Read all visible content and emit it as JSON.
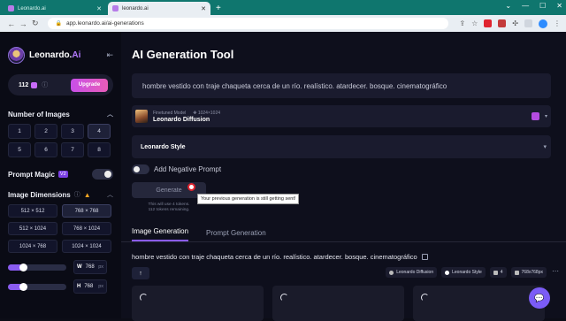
{
  "browser": {
    "tabs": [
      {
        "title": "Leonardo.ai",
        "active": false
      },
      {
        "title": "leonardo.ai",
        "active": true
      }
    ],
    "new_tab": "+",
    "url": "app.leonardo.ai/ai-generations",
    "icons": [
      "back-arrow",
      "forward-arrow",
      "reload",
      "lock",
      "share",
      "star",
      "extensions",
      "profile",
      "menu"
    ]
  },
  "sidebar": {
    "brand": "Leonardo.",
    "brand_suffix": "Ai",
    "collapse_icon": "collapse-arrow",
    "tokens": "112",
    "upgrade_label": "Upgrade",
    "number_of_images": {
      "title": "Number of Images",
      "options": [
        "1",
        "2",
        "3",
        "4",
        "5",
        "6",
        "7",
        "8"
      ],
      "selected": "4"
    },
    "prompt_magic": {
      "label": "Prompt Magic",
      "badge": "V2"
    },
    "image_dimensions": {
      "title": "Image Dimensions",
      "options": [
        "512 × 512",
        "768 × 768",
        "512 × 1024",
        "768 × 1024",
        "1024 × 768",
        "1024 × 1024"
      ],
      "selected": "768 × 768"
    },
    "width": {
      "label": "W",
      "value": "768",
      "unit": "px",
      "level": 0.25
    },
    "height": {
      "label": "H",
      "value": "768",
      "unit": "px",
      "level": 0.25
    }
  },
  "main": {
    "title": "AI Generation Tool",
    "prompt": "hombre vestido con traje chaqueta cerca de un río. realístico. atardecer. bosque. cinematográfico",
    "model": {
      "kind": "Finetuned Model",
      "resolution": "1024×1024",
      "name": "Leonardo Diffusion"
    },
    "style": "Leonardo Style",
    "negative_prompt_label": "Add Negative Prompt",
    "generate_label": "Generate",
    "tooltip": "Your previous generation is still getting sent!",
    "cost_note_1": "This will use 4 tokens.",
    "cost_note_2": "112 tokens remaining.",
    "tabs": [
      "Image Generation",
      "Prompt Generation"
    ],
    "generation": {
      "prompt": "hombre vestido con traje chaqueta cerca de un río. realístico. atardecer. bosque. cinematográfico",
      "up_icon": "↑",
      "chips": [
        "Leonardo Diffusion",
        "Leonardo Style",
        "4",
        "768x768px"
      ],
      "more": "⋯"
    },
    "chat_icon": "chat-bubble"
  },
  "colors": {
    "tab_bar": "#0f766e",
    "accent": "#8a5cf0",
    "upgrade": "#d955d0",
    "background": "#0e0f1c"
  }
}
